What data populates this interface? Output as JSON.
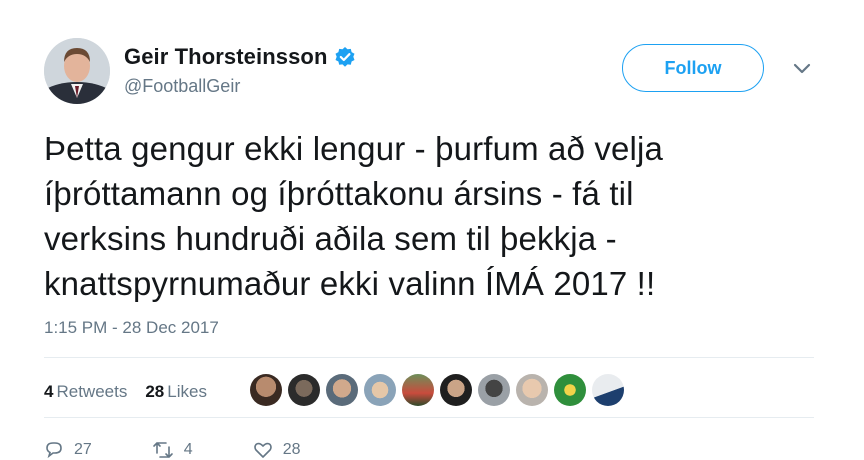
{
  "author": {
    "name": "Geir Thorsteinsson",
    "handle": "@FootballGeir",
    "verified": true
  },
  "follow_label": "Follow",
  "tweet": {
    "lines": [
      "Þetta gengur ekki lengur - þurfum að velja",
      "íþróttamann og íþróttakonu ársins - fá til",
      "verksins hundruði aðila sem til þekkja -",
      "knattspyrnumaður ekki valinn ÍMÁ 2017 !!"
    ]
  },
  "timestamp": "1:15 PM - 28 Dec 2017",
  "stats": {
    "retweets_count": "4",
    "retweets_label": "Retweets",
    "likes_count": "28",
    "likes_label": "Likes"
  },
  "actions": {
    "reply_count": "27",
    "retweet_count": "4",
    "like_count": "28"
  },
  "colors": {
    "accent": "#1da1f2",
    "secondary_text": "#657786",
    "primary_text": "#14171a",
    "divider": "#e6ecf0"
  }
}
